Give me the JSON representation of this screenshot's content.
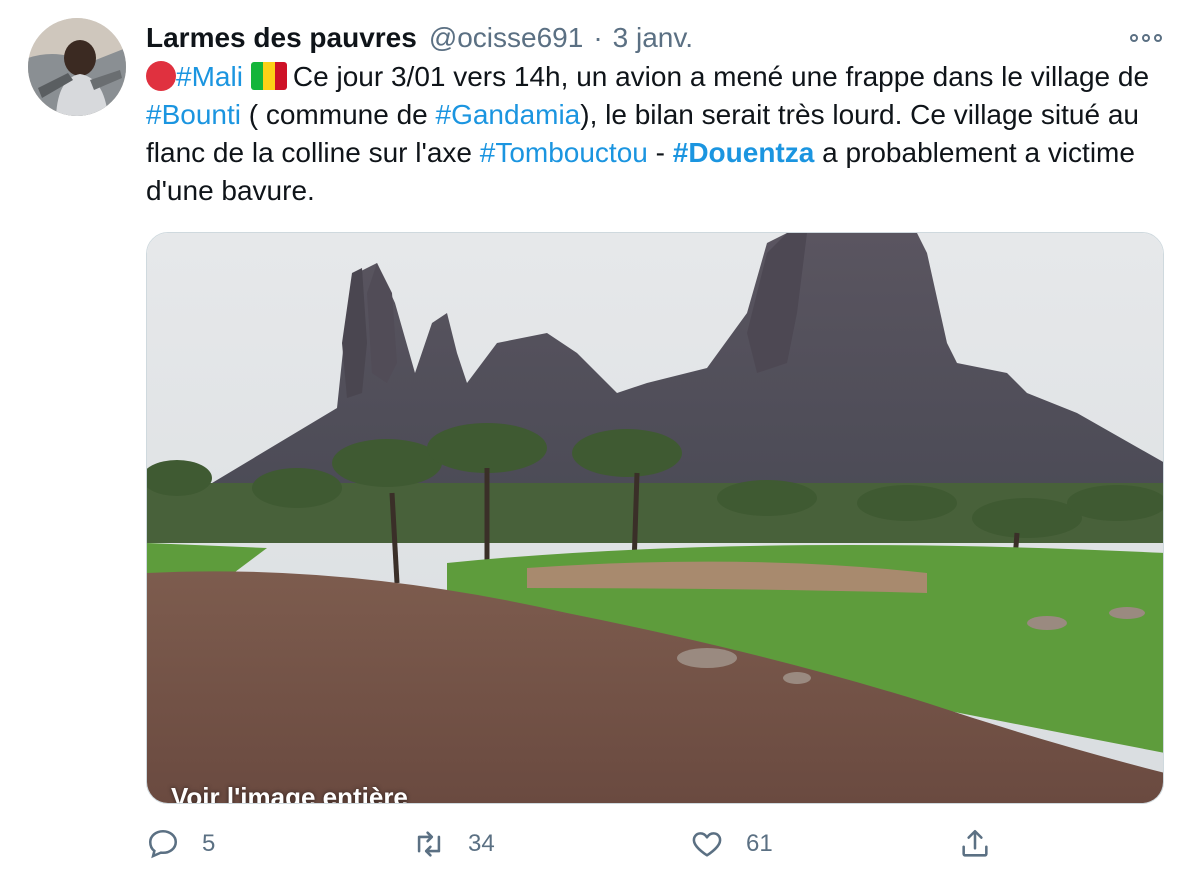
{
  "tweet": {
    "author": {
      "display_name": "Larmes des pauvres",
      "handle": "@ocisse691",
      "separator": "·",
      "date": "3 janv."
    },
    "text": {
      "red_circle_emoji": "🔴",
      "flag_emoji": "🇲🇱",
      "tag_mali": "#Mali",
      "seg1": "Ce jour 3/01 vers 14h, un avion a mené une frappe dans le village de ",
      "tag_bounti": "#Bounti",
      "seg2": " ( commune de ",
      "tag_gandamia": "#Gandamia",
      "seg3": "), le bilan serait très lourd. Ce village situé au flanc de la colline sur l'axe ",
      "tag_tombouctou": "#Tombouctou",
      "seg4": " - ",
      "tag_douentza": "#Douentza",
      "seg5": " a probablement a victime d'une bavure."
    },
    "media": {
      "caption": "Voir l'image entière",
      "description": "photo"
    },
    "actions": {
      "reply": {
        "icon": "reply-icon",
        "count": "5"
      },
      "retweet": {
        "icon": "retweet-icon",
        "count": "34"
      },
      "like": {
        "icon": "heart-icon",
        "count": "61"
      },
      "share": {
        "icon": "share-icon"
      }
    },
    "colors": {
      "link": "#1b95e0",
      "secondary": "#5b7083",
      "text": "#0f1419"
    }
  }
}
